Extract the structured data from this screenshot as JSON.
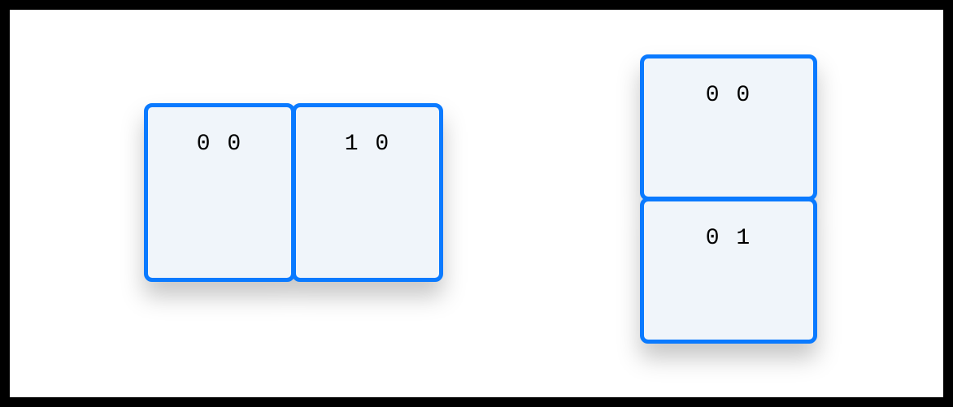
{
  "diagram": {
    "group_row": {
      "orientation": "horizontal",
      "boxes": [
        {
          "label": "0 0"
        },
        {
          "label": "1 0"
        }
      ]
    },
    "group_col": {
      "orientation": "vertical",
      "boxes": [
        {
          "label": "0 0"
        },
        {
          "label": "0 1"
        }
      ]
    },
    "style": {
      "border_color": "#0a7aff",
      "fill_color": "#f0f5fa"
    }
  }
}
